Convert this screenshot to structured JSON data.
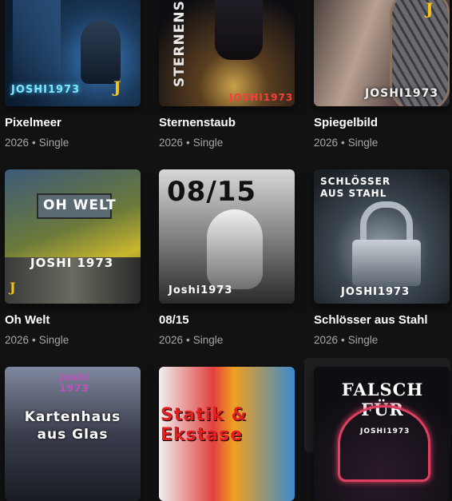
{
  "releases": [
    {
      "title": "Pixelmeer",
      "year": "2026",
      "type": "Single",
      "cover_text": "JOSHI1973",
      "colors": [
        "#0b1a2e",
        "#1b3a5c",
        "#3a7bbf"
      ]
    },
    {
      "title": "Sternenstaub",
      "year": "2026",
      "type": "Single",
      "cover_text": "JOSHI1973",
      "cover_title": "STERNENSTA",
      "colors": [
        "#0d0d12",
        "#2a2530",
        "#c8a14a"
      ]
    },
    {
      "title": "Spiegelbild",
      "year": "2026",
      "type": "Single",
      "cover_text": "JOSHI1973",
      "colors": [
        "#2a2a2e",
        "#5a4a48",
        "#b8a090"
      ]
    },
    {
      "title": "Oh Welt",
      "year": "2026",
      "type": "Single",
      "cover_text": "JOSHI 1973",
      "cover_title": "OH WELT",
      "colors": [
        "#2b3a1e",
        "#6b7a3a",
        "#c9b62e"
      ]
    },
    {
      "title": "08/15",
      "year": "2026",
      "type": "Single",
      "cover_text": "Joshi1973",
      "cover_title": "08/15",
      "colors": [
        "#1a1a1a",
        "#4a4a4a",
        "#d0d0d0"
      ]
    },
    {
      "title": "Schlösser aus Stahl",
      "year": "2026",
      "type": "Single",
      "cover_text": "JOSHI1973",
      "cover_title": "SCHLÖSSER AUS STAHL",
      "colors": [
        "#1a1f24",
        "#3c4650",
        "#9aa6b0"
      ]
    },
    {
      "title": "",
      "year": "",
      "type": "",
      "cover_text": "Joshi 1973",
      "cover_title": "Kartenhaus aus Glas",
      "colors": [
        "#1a1c24",
        "#3a3e4c",
        "#8088a0"
      ]
    },
    {
      "title": "",
      "year": "",
      "type": "",
      "cover_text": "",
      "cover_title": "Statik & Ekstase",
      "colors": [
        "#f0f0f0",
        "#e04040",
        "#3a8ad0"
      ]
    },
    {
      "title": "",
      "year": "",
      "type": "",
      "cover_text": "JOSHI1973",
      "cover_title": "FALSCH FÜR",
      "colors": [
        "#0e0e12",
        "#2a1a2a",
        "#e04060"
      ]
    }
  ],
  "separator": "•"
}
